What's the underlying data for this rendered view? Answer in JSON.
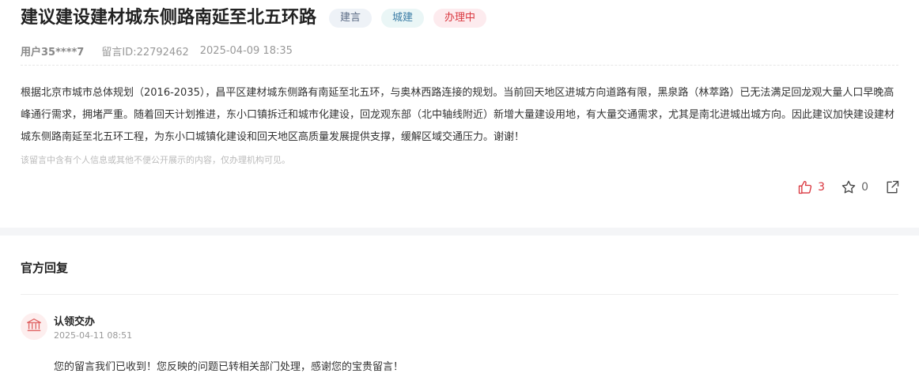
{
  "post": {
    "title": "建议建设建材城东侧路南延至北五环路",
    "tags": [
      {
        "label": "建言",
        "bg": "#eef2f7",
        "color": "#5b6b85"
      },
      {
        "label": "城建",
        "bg": "#eaf6f6",
        "color": "#3a7ca5"
      },
      {
        "label": "办理中",
        "bg": "#fdebee",
        "color": "#d9363e"
      }
    ],
    "user": "用户35****7",
    "message_id": "留言ID:22792462",
    "datetime": "2025-04-09 18:35",
    "content": "根据北京市城市总体规划（2016-2035），昌平区建材城东侧路有南延至北五环，与奥林西路连接的规划。当前回天地区进城方向道路有限，黑泉路（林萃路）已无法满足回龙观大量人口早晚高峰通行需求，拥堵严重。随着回天计划推进，东小口镇拆迁和城市化建设，回龙观东部（北中轴线附近）新增大量建设用地，有大量交通需求，尤其是南北进城出城方向。因此建议加快建设建材城东侧路南延至北五环工程，为东小口城镇化建设和回天地区高质量发展提供支撑，缓解区域交通压力。谢谢！",
    "privacy_notice": "该留言中含有个人信息或其他不便公开展示的内容，仅办理机构可见。",
    "likes": "3",
    "favorites": "0",
    "like_color": "#d9363e"
  },
  "reply": {
    "section_title": "官方回复",
    "org_name": "认领交办",
    "datetime": "2025-04-11 08:51",
    "text": "您的留言我们已收到！您反映的问题已转相关部门处理，感谢您的宝贵留言！",
    "avatar_color": "#e06666"
  }
}
